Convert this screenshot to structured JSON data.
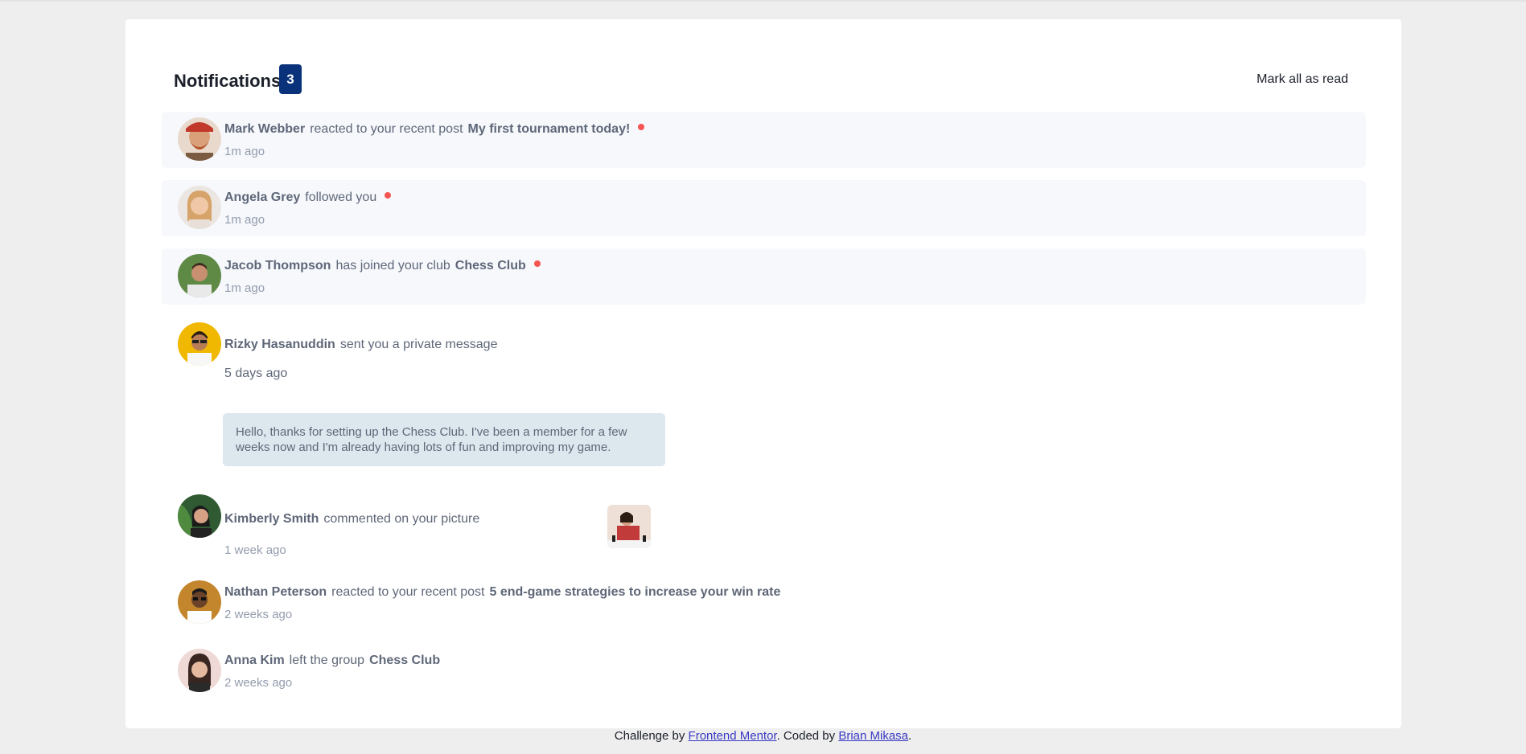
{
  "header": {
    "title": "Notifications",
    "unread_count": "3",
    "mark_all_label": "Mark all as read"
  },
  "notifications": [
    {
      "name": "Mark Webber",
      "action": "reacted to your recent post",
      "target": "My first tournament today!",
      "time": "1m ago",
      "unread": true,
      "avatar_color": "#c8704a"
    },
    {
      "name": "Angela Grey",
      "action": "followed you",
      "target": "",
      "time": "1m ago",
      "unread": true,
      "avatar_color": "#d7b08e"
    },
    {
      "name": "Jacob Thompson",
      "action": "has joined your club",
      "target": "Chess Club",
      "time": "1m ago",
      "unread": true,
      "avatar_color": "#4e7a3d"
    },
    {
      "name": "Rizky Hasanuddin",
      "action": "sent you a private message",
      "target": "",
      "time": "5 days ago",
      "unread": false,
      "avatar_color": "#e9b61e",
      "message": "Hello, thanks for setting up the Chess Club. I've been a member for a few weeks now and I'm already having lots of fun and improving my game."
    },
    {
      "name": "Kimberly Smith",
      "action": "commented on your picture",
      "target": "",
      "time": "1 week ago",
      "unread": false,
      "avatar_color": "#2f5a32",
      "thumb_color": "#c23b3b"
    },
    {
      "name": "Nathan Peterson",
      "action": "reacted to your recent post",
      "target": "5 end-game strategies to increase your win rate",
      "time": "2 weeks ago",
      "unread": false,
      "avatar_color": "#c4862c"
    },
    {
      "name": "Anna Kim",
      "action": "left the group",
      "target": "Chess Club",
      "time": "2 weeks ago",
      "unread": false,
      "avatar_color": "#d9a7a0"
    }
  ],
  "footer": {
    "prefix": "Challenge by ",
    "link1": "Frontend Mentor",
    "middle": ". Coded by ",
    "link2": "Brian Mikasa",
    "suffix": "."
  },
  "colors": {
    "badge": "#0a327b",
    "unread_dot": "#f65552",
    "unread_bg": "#f6f8fc"
  }
}
